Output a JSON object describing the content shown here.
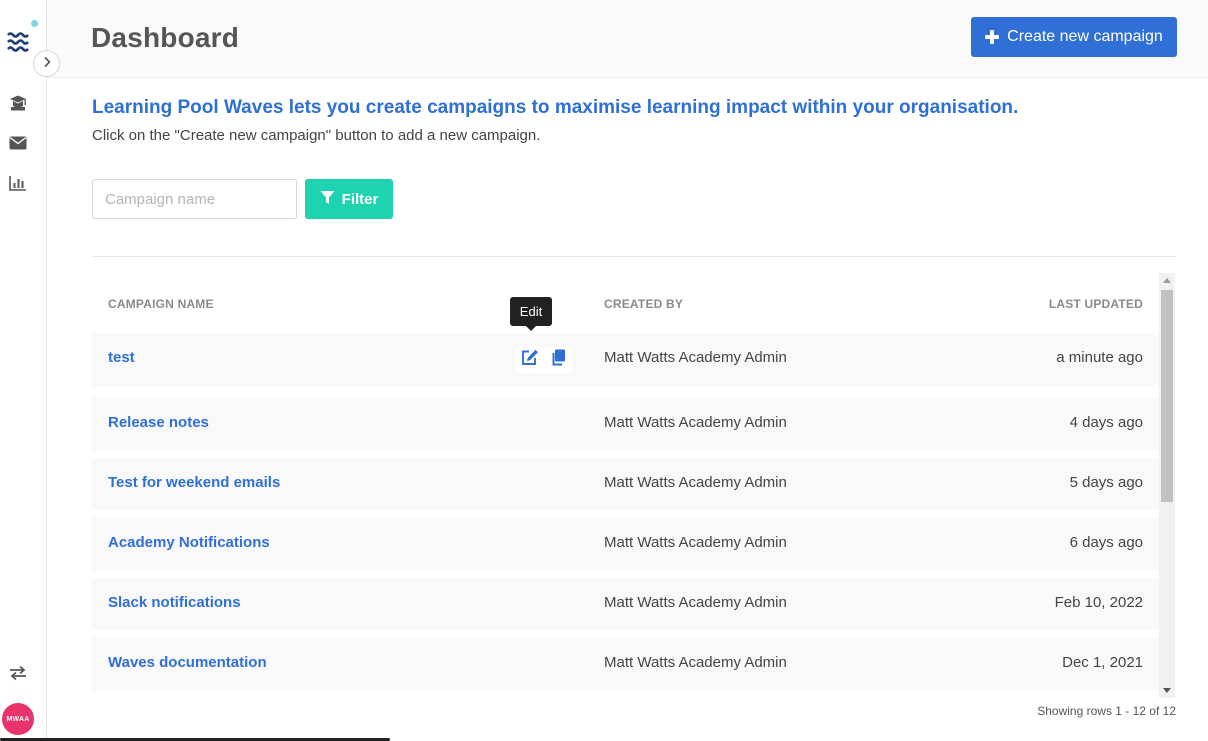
{
  "header": {
    "title": "Dashboard",
    "create_label": "Create new campaign"
  },
  "sidebar": {
    "items": [
      {
        "icon": "graduation-cap-icon"
      },
      {
        "icon": "envelope-icon"
      },
      {
        "icon": "bar-chart-icon"
      }
    ],
    "bottom_icon": "swap-arrows-icon",
    "avatar_initials": "MWAA"
  },
  "intro": {
    "title": "Learning Pool Waves lets you create campaigns to maximise learning impact within your organisation.",
    "subtitle": "Click on the \"Create new campaign\" button to add a new campaign."
  },
  "filter": {
    "placeholder": "Campaign name",
    "value": "",
    "button_label": "Filter"
  },
  "table": {
    "columns": {
      "name": "CAMPAIGN NAME",
      "created_by": "CREATED BY",
      "last_updated": "LAST UPDATED"
    },
    "rows": [
      {
        "name": "test",
        "created_by": "Matt Watts Academy Admin",
        "last_updated": "a minute ago"
      },
      {
        "name": "Release notes",
        "created_by": "Matt Watts Academy Admin",
        "last_updated": "4 days ago"
      },
      {
        "name": "Test for weekend emails",
        "created_by": "Matt Watts Academy Admin",
        "last_updated": "5 days ago"
      },
      {
        "name": "Academy Notifications",
        "created_by": "Matt Watts Academy Admin",
        "last_updated": "6 days ago"
      },
      {
        "name": "Slack notifications",
        "created_by": "Matt Watts Academy Admin",
        "last_updated": "Feb 10, 2022"
      },
      {
        "name": "Waves documentation",
        "created_by": "Matt Watts Academy Admin",
        "last_updated": "Dec 1, 2021"
      }
    ],
    "tooltip": "Edit",
    "footer": "Showing rows 1 - 12 of 12"
  },
  "colors": {
    "primary": "#2f6fd6",
    "filter": "#1dd3b0",
    "avatar": "#e8336b"
  }
}
